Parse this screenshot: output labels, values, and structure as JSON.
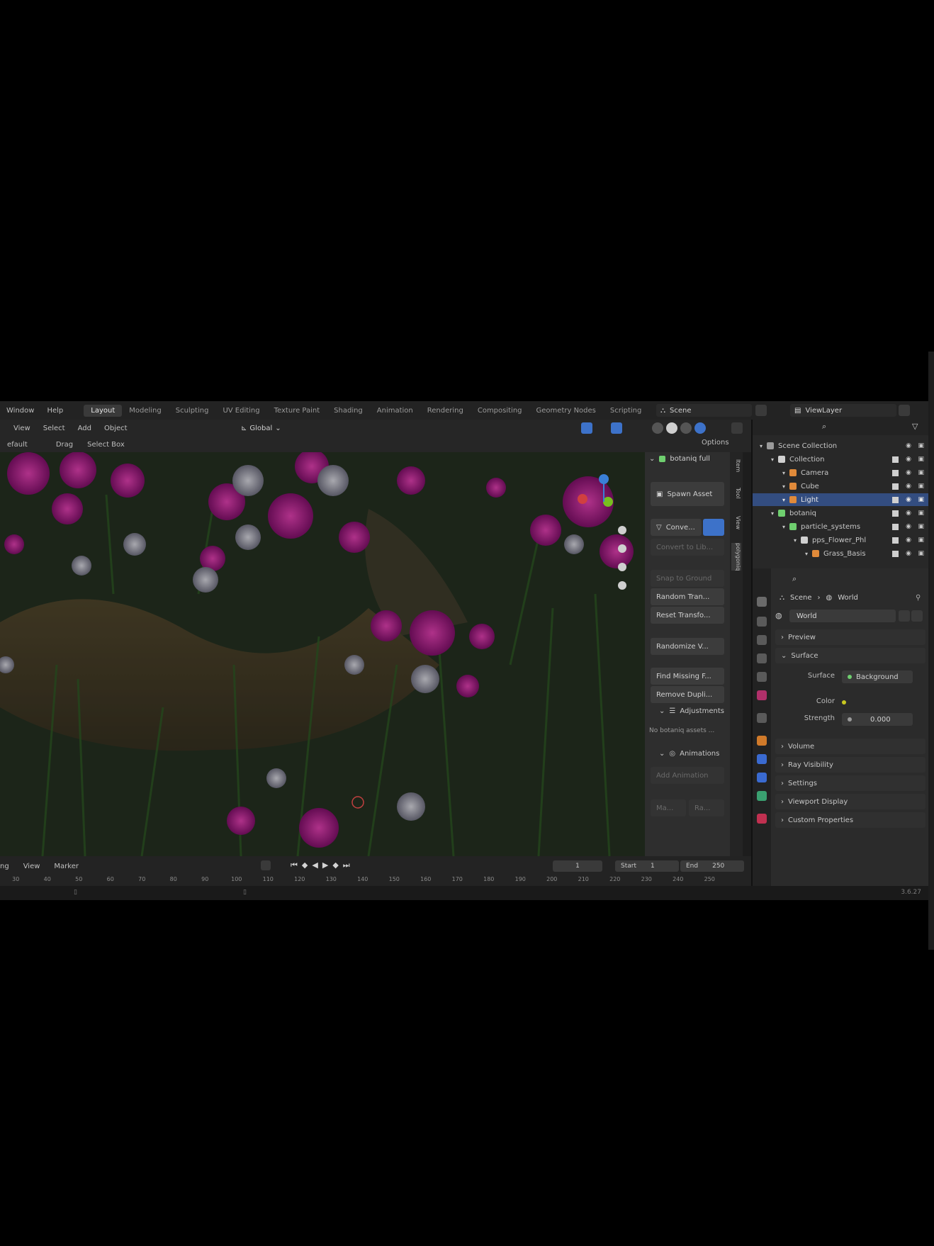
{
  "menus": [
    "Window",
    "Help"
  ],
  "workspaces": [
    "Layout",
    "Modeling",
    "Sculpting",
    "UV Editing",
    "Texture Paint",
    "Shading",
    "Animation",
    "Rendering",
    "Compositing",
    "Geometry Nodes",
    "Scripting"
  ],
  "active_workspace": "Layout",
  "scene": "Scene",
  "view_layer": "ViewLayer",
  "viewport_header": {
    "items": [
      "View",
      "Select",
      "Add",
      "Object"
    ],
    "transform": "Global"
  },
  "tool_header": {
    "mode": "efault",
    "drag_label": "Drag",
    "select_mode": "Select Box",
    "options": "Options"
  },
  "npanel": {
    "title": "botaniq full",
    "buttons": [
      {
        "label": "Spawn Asset",
        "dim": false
      },
      {
        "label": "Conve...",
        "dim": false
      },
      {
        "label": "Convert to Lib...",
        "dim": true
      },
      {
        "label": "Snap to Ground",
        "dim": true
      },
      {
        "label": "Random Tran...",
        "dim": false
      },
      {
        "label": "Reset Transfo...",
        "dim": false
      },
      {
        "label": "Randomize V...",
        "dim": false
      },
      {
        "label": "Find Missing F...",
        "dim": false
      },
      {
        "label": "Remove Dupli...",
        "dim": false
      }
    ],
    "adjustments": "Adjustments",
    "note": "No botaniq assets ...",
    "animations": "Animations",
    "add_animation": "Add Animation",
    "bottom": "Ma...",
    "bottom2": "Ra..."
  },
  "side_tabs": [
    "Item",
    "Tool",
    "View",
    "polygoniq"
  ],
  "timeline": {
    "items": [
      "ng",
      "View",
      "Marker"
    ],
    "current_frame": "1",
    "start_label": "Start",
    "start": "1",
    "end_label": "End",
    "end": "250",
    "ruler": [
      "30",
      "40",
      "50",
      "60",
      "70",
      "80",
      "90",
      "100",
      "110",
      "120",
      "130",
      "140",
      "150",
      "160",
      "170",
      "180",
      "190",
      "200",
      "210",
      "220",
      "230",
      "240",
      "250"
    ]
  },
  "outliner": {
    "rows": [
      {
        "label": "Scene Collection",
        "indent": 0,
        "color": "#9a9a9a",
        "selected": false
      },
      {
        "label": "Collection",
        "indent": 1,
        "color": "#d0d0d0",
        "selected": false
      },
      {
        "label": "Camera",
        "indent": 2,
        "color": "#e08a3a",
        "selected": false
      },
      {
        "label": "Cube",
        "indent": 2,
        "color": "#e08a3a",
        "selected": false
      },
      {
        "label": "Light",
        "indent": 2,
        "color": "#e08a3a",
        "selected": true
      },
      {
        "label": "botaniq",
        "indent": 1,
        "color": "#6fcf6f",
        "selected": false
      },
      {
        "label": "particle_systems",
        "indent": 2,
        "color": "#6fcf6f",
        "selected": false
      },
      {
        "label": "pps_Flower_Phl",
        "indent": 3,
        "color": "#d0d0d0",
        "selected": false
      },
      {
        "label": "Grass_Basis",
        "indent": 4,
        "color": "#e08a3a",
        "selected": false
      }
    ]
  },
  "properties": {
    "crumb_scene": "Scene",
    "crumb_world": "World",
    "world": "World",
    "panels": [
      "Preview",
      "Surface"
    ],
    "surface_label": "Surface",
    "surface_value": "Background",
    "color_label": "Color",
    "strength_label": "Strength",
    "strength_value": "0.000",
    "more_panels": [
      "Volume",
      "Ray Visibility",
      "Settings",
      "Viewport Display",
      "Custom Properties"
    ]
  },
  "version": "3.6.27",
  "colors": {
    "accent": "#3d72c9",
    "selection": "#334d80",
    "flower_magenta": "#c0208c"
  }
}
